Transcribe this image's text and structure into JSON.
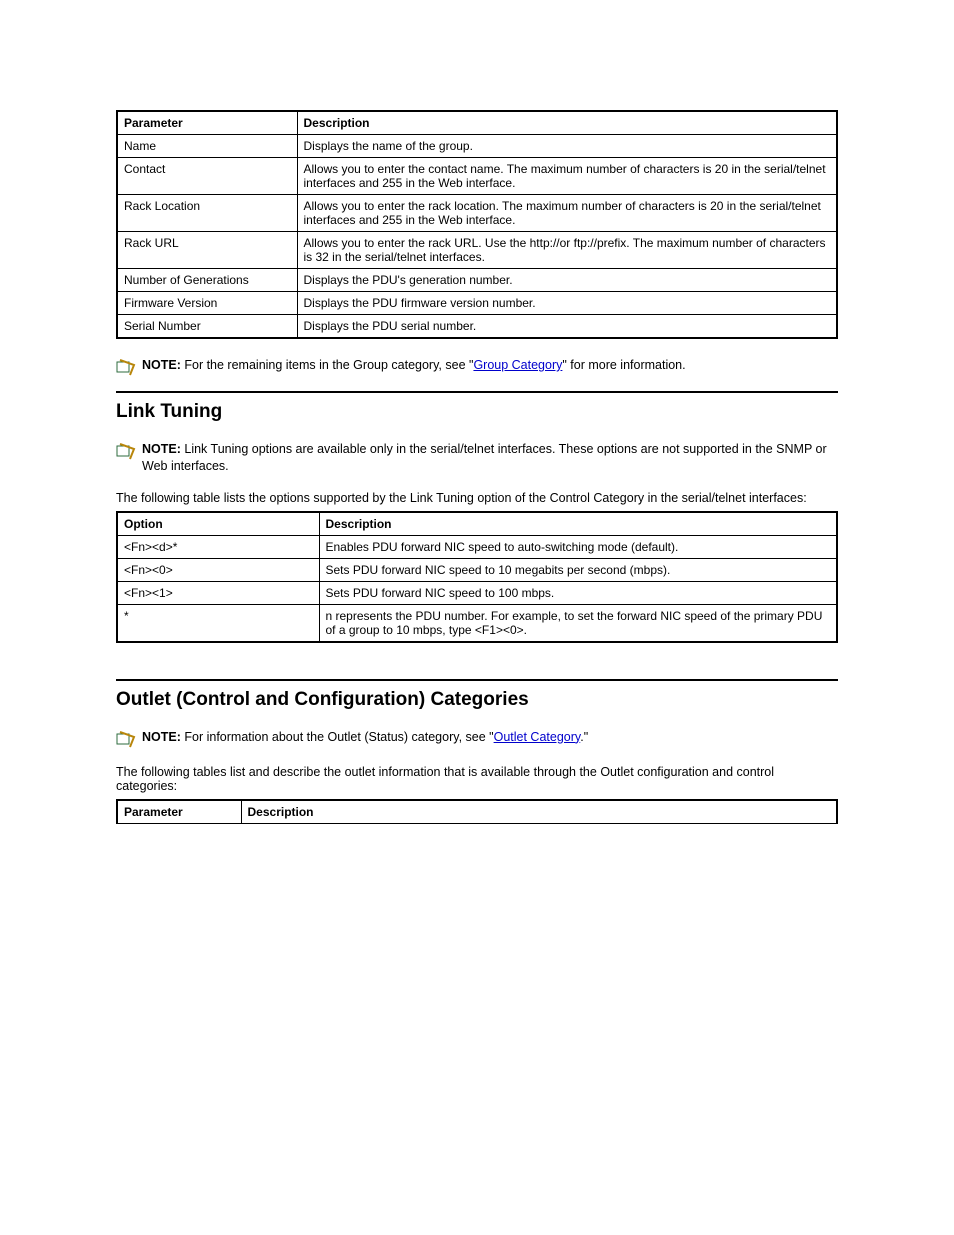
{
  "note_label": "NOTE:",
  "table1": {
    "headers": [
      "Parameter",
      "Description"
    ],
    "rows": [
      [
        "Name",
        "Displays the name of the group."
      ],
      [
        "Contact",
        "Allows you to enter the contact name. The maximum number of characters is 20 in the serial/telnet interfaces and 255 in the Web interface."
      ],
      [
        "Rack Location",
        "Allows you to enter the rack location. The maximum number of characters is 20 in the serial/telnet interfaces and 255 in the Web interface."
      ],
      [
        "Rack URL",
        "Allows you to enter the rack URL. Use the http://or ftp://prefix. The maximum number of characters is 32 in the serial/telnet interfaces."
      ],
      [
        "Number of Generations",
        "Displays the PDU's generation number."
      ],
      [
        "Firmware Version",
        "Displays the PDU firmware version number."
      ],
      [
        "Serial Number",
        "Displays the PDU serial number."
      ]
    ]
  },
  "note1_a": " For the remaining items in the Group category, see \"",
  "note1_link": "Group Category",
  "note1_b": "\" for more information.",
  "section2_title": "Link Tuning",
  "note2": " Link Tuning options are available only in the serial/telnet interfaces. These options are not supported in the SNMP or Web interfaces.",
  "intro2": "The following table lists the options supported by the Link Tuning option of the Control Category in the serial/telnet interfaces:",
  "table2": {
    "headers": [
      "Option",
      "Description"
    ],
    "rows": [
      [
        "<Fn><d>*",
        "Enables PDU forward NIC speed to auto-switching mode (default)."
      ],
      [
        "<Fn><0>",
        "Sets PDU forward NIC speed to 10 megabits per second (mbps)."
      ],
      [
        "<Fn><1>",
        "Sets PDU forward NIC speed to 100 mbps."
      ],
      [
        "*",
        "n represents the PDU number. For example, to set the forward NIC speed of the primary PDU of a group to 10 mbps, type <F1><0>."
      ]
    ]
  },
  "section3_title": "Outlet (Control and Configuration) Categories",
  "note3_a": " For information about the Outlet (Status) category, see \"",
  "note3_link": "Outlet Category",
  "note3_b": ".\"",
  "intro3": "The following tables list and describe the outlet information that is available through the Outlet configuration and control categories:",
  "table3": {
    "headers": [
      "Parameter",
      "Description"
    ]
  }
}
